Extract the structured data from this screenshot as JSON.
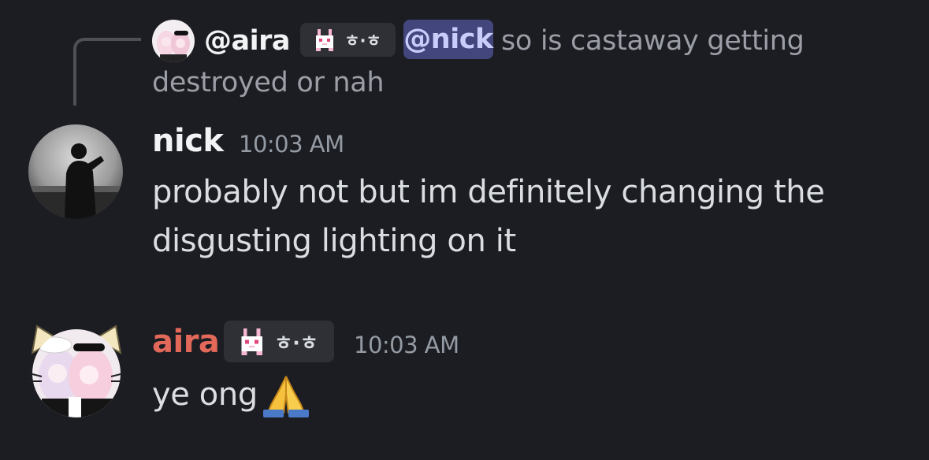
{
  "reply": {
    "author": "@aira",
    "author_tag": "ㅎ·ㅎ",
    "author_tag_icon": "bunny-pixel-icon",
    "mention": "@nick",
    "text_line1": "so is castaway getting",
    "text_line2": "destroyed or nah"
  },
  "messages": [
    {
      "author": "nick",
      "timestamp": "10:03 AM",
      "lines": [
        "probably not but im definitely changing the",
        "disgusting lighting on it"
      ]
    },
    {
      "author": "aira",
      "author_tag": "ㅎ·ㅎ",
      "author_tag_icon": "bunny-pixel-icon",
      "timestamp": "10:03 AM",
      "text": "ye ong",
      "emoji": "folded-hands-emoji"
    }
  ],
  "colors": {
    "background": "#1c1d22",
    "aira_name": "#e2685a",
    "nick_name": "#f2f3f5",
    "mention_bg": "#43467c",
    "mention_text": "#c9cdfb",
    "muted_text": "#9b9ea6",
    "timestamp": "#949ba4"
  }
}
